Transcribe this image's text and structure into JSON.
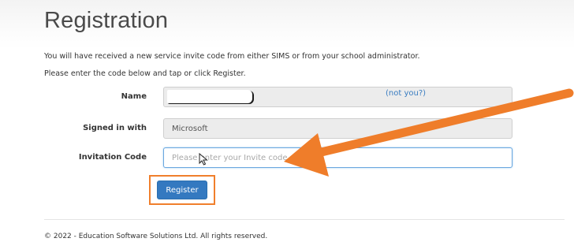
{
  "page": {
    "title": "Registration",
    "intro_line_1": "You will have received a new service invite code from either SIMS or from your school administrator.",
    "intro_line_2": "Please enter the code below and tap or click Register."
  },
  "form": {
    "name_label": "Name",
    "not_you_link": "(not you?)",
    "signed_in_label": "Signed in with",
    "signed_in_value": "Microsoft",
    "invitation_label": "Invitation Code",
    "invitation_value": "",
    "invitation_placeholder": "Please enter your Invite code",
    "register_label": "Register"
  },
  "footer": {
    "copyright": "© 2022 - Education Software Solutions Ltd. All rights reserved."
  },
  "annotations": {
    "arrow_color": "#ef7d2a",
    "highlight_color": "#f07f2c"
  },
  "icons": {
    "pointer": "mouse-pointer-icon",
    "arrow": "annotation-arrow"
  }
}
